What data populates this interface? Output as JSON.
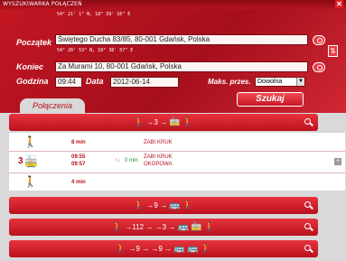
{
  "window": {
    "title": "WYSZUKIWARKA POŁĄCZEŃ",
    "close_label": "✕"
  },
  "form": {
    "from_coords": "54° 21' 1\" N, 18° 39' 16\" E",
    "from_label": "Początek",
    "from_value": "Świętego Ducha 83/85, 80-001 Gdańsk, Polska",
    "to_coords": "54° 20' 53\" N, 18° 38' 57\" E",
    "to_label": "Koniec",
    "to_value": "Za Murami 10, 80-001 Gdańsk, Polska",
    "time_label": "Godzina",
    "time_value": "09:44",
    "date_label": "Data",
    "date_value": "2012-06-14",
    "max_transfers_label": "Maks. przes.",
    "max_transfers_value": "Dowolna",
    "search_button": "Szukaj"
  },
  "tab": {
    "label": "Połączenia"
  },
  "connections": [
    {
      "route": "→3 → "
    },
    {
      "route": "→9 → "
    },
    {
      "route": "→112 → →3 → "
    },
    {
      "route": "→9 → →9 → "
    }
  ],
  "detail": {
    "walk1_duration": "8 min",
    "walk1_stop": "ŻABI KRUK",
    "tram_number": "3",
    "tram_depart": "09:55",
    "tram_arrive": "09:57",
    "tram_duration": "0 min",
    "tram_stop_from": "ŻABI KRUK",
    "tram_stop_to": "OKOPOWA",
    "walk2_duration": "4 min"
  },
  "colors": {
    "brand_red": "#c31623",
    "accent": "#e93a44"
  },
  "icons": [
    "walking-person-icon",
    "tram-icon",
    "bus-icon",
    "magnifier-icon",
    "eye-icon",
    "swap-icon"
  ]
}
